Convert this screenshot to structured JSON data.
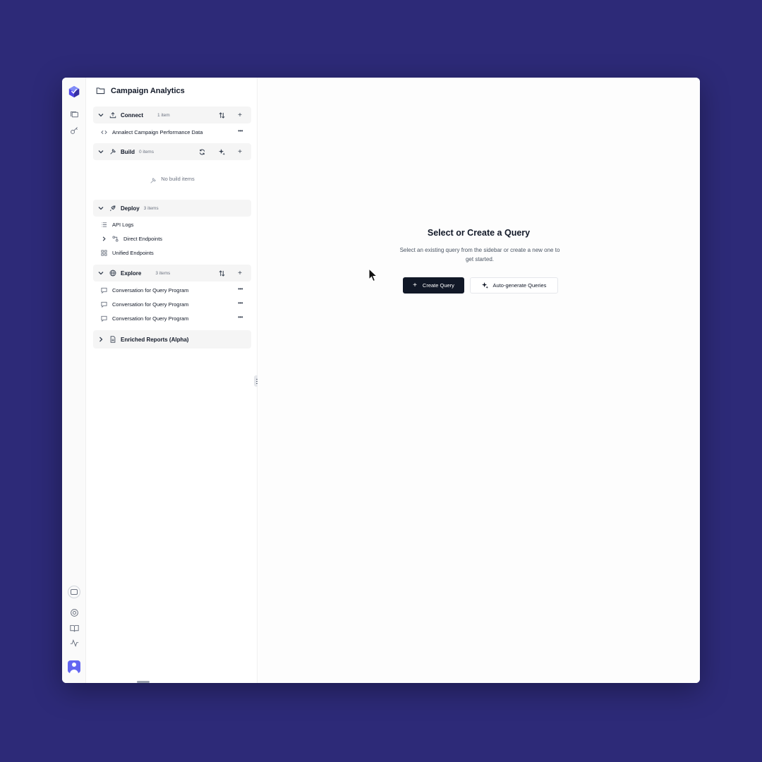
{
  "workspace": {
    "title": "Campaign Analytics"
  },
  "sections": {
    "connect": {
      "name": "Connect",
      "count": "1 item",
      "items": [
        {
          "label": "Annalect Campaign Performance Data"
        }
      ]
    },
    "build": {
      "name": "Build",
      "count": "0 items",
      "empty_label": "No build items"
    },
    "deploy": {
      "name": "Deploy",
      "count": "3 items",
      "items": [
        {
          "label": "API Logs"
        },
        {
          "label": "Direct Endpoints"
        },
        {
          "label": "Unified Endpoints"
        }
      ]
    },
    "explore": {
      "name": "Explore",
      "count": "3 items",
      "items": [
        {
          "label": "Conversation for Query Program"
        },
        {
          "label": "Conversation for Query Program"
        },
        {
          "label": "Conversation for Query Program"
        }
      ]
    },
    "enriched": {
      "name": "Enriched Reports (Alpha)"
    }
  },
  "main": {
    "heading": "Select or Create a Query",
    "subtext": "Select an existing query from the sidebar or create a new one to get started.",
    "create_label": "Create Query",
    "autogen_label": "Auto-generate Queries"
  },
  "colors": {
    "background": "#2d2a78",
    "primary_button": "#111827",
    "avatar": "#6366f1"
  }
}
